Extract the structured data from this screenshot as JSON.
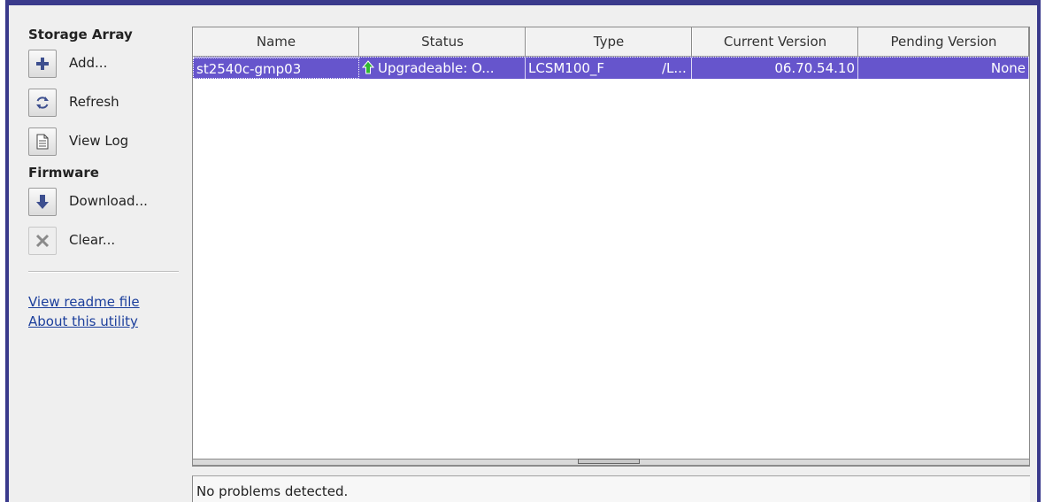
{
  "sidebar": {
    "storage_title": "Storage Array",
    "storage_actions": [
      {
        "label": "Add...",
        "icon": "plus-icon"
      },
      {
        "label": "Refresh",
        "icon": "refresh-icon"
      },
      {
        "label": "View Log",
        "icon": "document-icon"
      }
    ],
    "firmware_title": "Firmware",
    "firmware_actions": [
      {
        "label": "Download...",
        "icon": "download-arrow-icon"
      },
      {
        "label": "Clear...",
        "icon": "clear-x-icon"
      }
    ],
    "links": [
      "View readme file",
      "About this utility"
    ]
  },
  "table": {
    "columns": [
      "Name",
      "Status",
      "Type",
      "Current Version",
      "Pending Version"
    ],
    "rows": [
      {
        "name": "st2540c-gmp03",
        "status": "Upgradeable: O...",
        "type": "LCSM100_F",
        "type_suffix": "/L...",
        "current_version": "06.70.54.10",
        "pending_version": "None"
      }
    ],
    "selected_row_color": "#6655cc"
  },
  "status_bar": {
    "message": "No problems detected."
  },
  "colors": {
    "window_border": "#3a3a8c",
    "link": "#1c3f9c",
    "status_arrow": "#2fb82f"
  }
}
